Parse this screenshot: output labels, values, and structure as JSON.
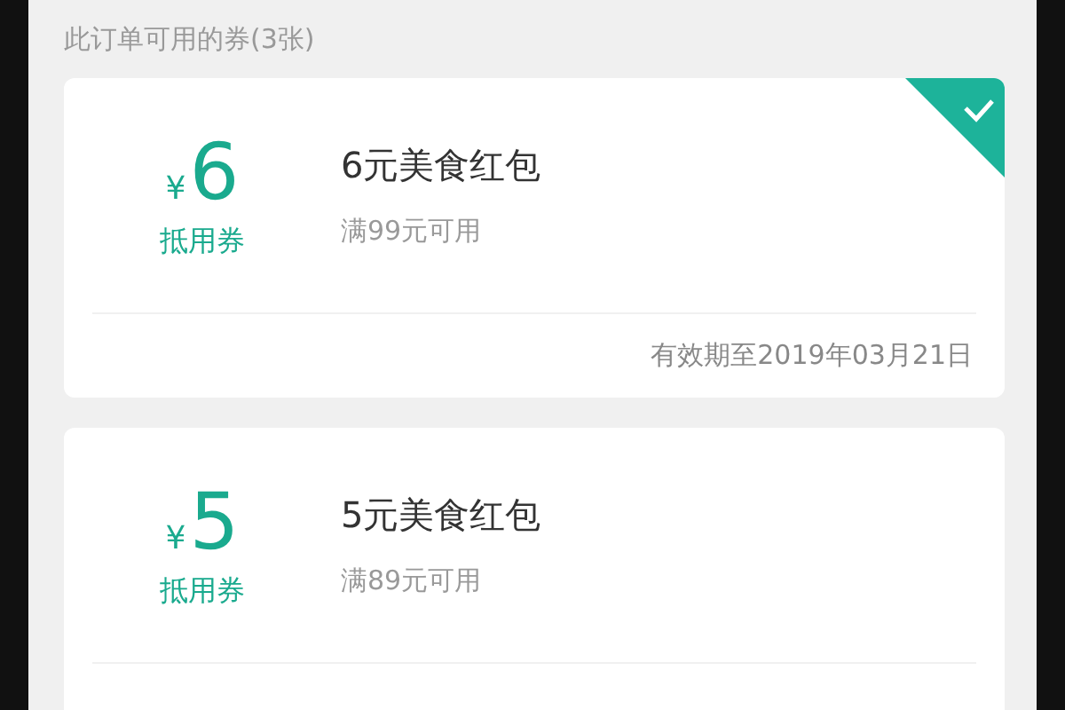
{
  "section_title": "此订单可用的券(3张)",
  "coupons": [
    {
      "currency": "¥",
      "amount": "6",
      "type_label": "抵用券",
      "title": "6元美食红包",
      "condition": "满99元可用",
      "expiry": "有效期至2019年03月21日",
      "selected": true
    },
    {
      "currency": "¥",
      "amount": "5",
      "type_label": "抵用券",
      "title": "5元美食红包",
      "condition": "满89元可用",
      "selected": false
    }
  ]
}
